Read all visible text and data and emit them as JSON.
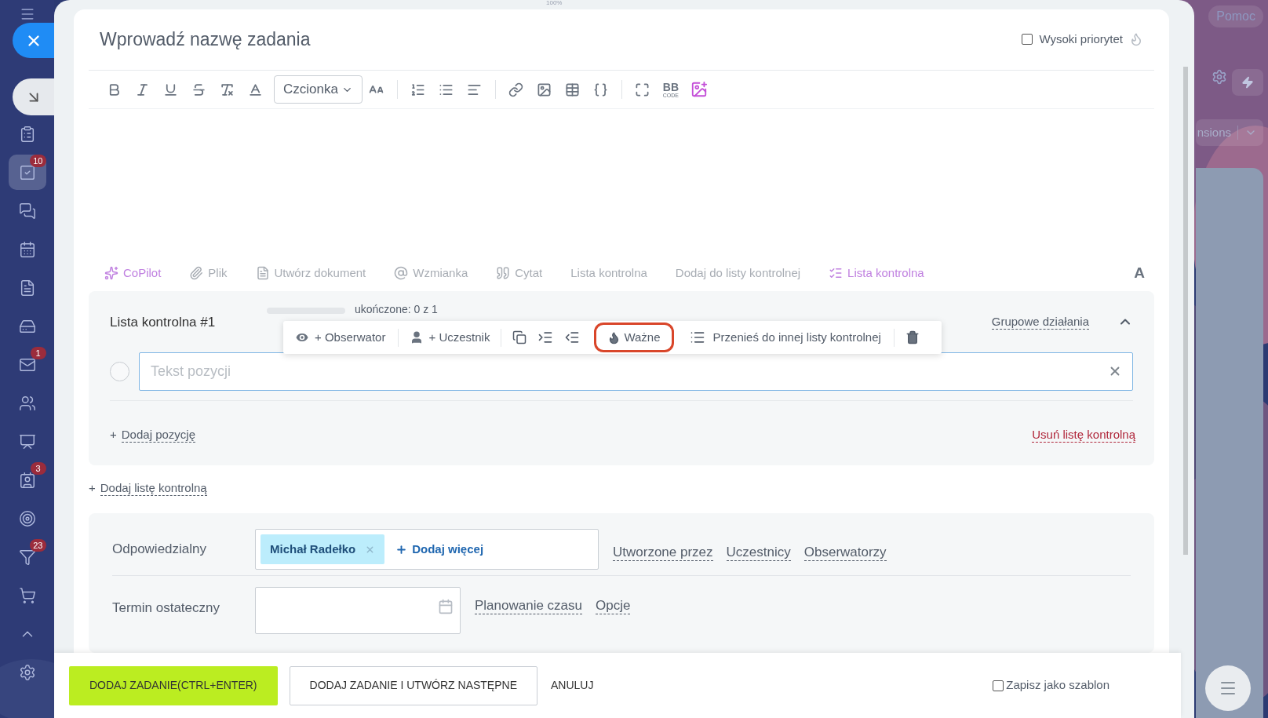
{
  "top_bar": {
    "zoom": "100%",
    "help": "Pomoc",
    "extensions": "nsions"
  },
  "sidebar": {
    "items": [
      {
        "selected": false
      },
      {
        "selected": true,
        "badge": "10"
      },
      {
        "selected": false
      },
      {
        "selected": false
      },
      {
        "selected": false
      },
      {
        "selected": false
      },
      {
        "selected": false,
        "badge": "1"
      },
      {
        "selected": false
      },
      {
        "selected": false
      },
      {
        "selected": false,
        "badge": "3"
      },
      {
        "selected": false
      },
      {
        "selected": false,
        "badge": "23"
      },
      {
        "selected": false
      },
      {
        "selected": false
      },
      {
        "selected": false
      }
    ]
  },
  "task": {
    "title_placeholder": "Wprowadź nazwę zadania",
    "high_priority": {
      "label": "Wysoki priorytet",
      "checked": false
    }
  },
  "editor_toolbar": {
    "font": "Czcionka",
    "bb": "BB",
    "bb_sub": "CODE"
  },
  "editor_actions": [
    {
      "kind": "copilot",
      "label": "CoPilot"
    },
    {
      "kind": "file",
      "label": "Plik"
    },
    {
      "kind": "document",
      "label": "Utwórz dokument"
    },
    {
      "kind": "mention",
      "label": "Wzmianka"
    },
    {
      "kind": "quote",
      "label": "Cytat"
    },
    {
      "kind": "plain",
      "label": "Lista kontrolna"
    },
    {
      "kind": "plain",
      "label": "Dodaj do listy kontrolnej"
    },
    {
      "kind": "checklist",
      "label": "Lista kontrolna"
    }
  ],
  "editor_format_letter": "A",
  "checklist": {
    "title": "Lista kontrolna #1",
    "progress": {
      "level": 0,
      "text": "ukończone: 0 z 1"
    },
    "group_actions": "Grupowe działania",
    "expanded": true,
    "floating_toolbar": {
      "observer": "+ Obserwator",
      "participant": "+ Uczestnik",
      "important": {
        "label": "Ważne",
        "highlighted": true
      },
      "move": "Przenieś do innej listy kontrolnej"
    },
    "items": [
      {
        "placeholder": "Tekst pozycji",
        "checked": false
      }
    ],
    "add_item": {
      "plus": "+",
      "label": "Dodaj pozycję"
    },
    "delete": "Usuń listę kontrolną"
  },
  "add_checklist": {
    "plus": "+",
    "label": "Dodaj listę kontrolną"
  },
  "form": {
    "responsible": {
      "label": "Odpowiedzialny",
      "person": "Michał Radełko",
      "add_more": "Dodaj więcej",
      "links": [
        "Utworzone przez",
        "Uczestnicy",
        "Obserwatorzy"
      ]
    },
    "deadline": {
      "label": "Termin ostateczny",
      "links": [
        "Planowanie czasu",
        "Opcje"
      ]
    }
  },
  "footer": {
    "primary": "DODAJ ZADANIE(CTRL+ENTER)",
    "secondary": "DODAJ ZADANIE I UTWÓRZ NASTĘPNE",
    "cancel": "ANULUJ",
    "template": {
      "label": "Zapisz jako szablon",
      "checked": false
    }
  }
}
